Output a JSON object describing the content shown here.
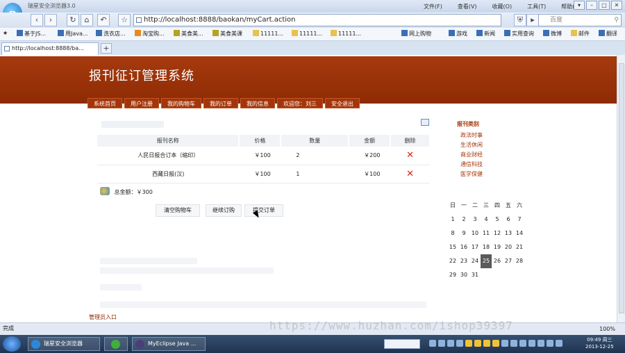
{
  "browser": {
    "window_title": "瑞星安全浏览器3.0",
    "logo": "e",
    "menu": [
      "文件(F)",
      "查看(V)",
      "收藏(O)",
      "工具(T)",
      "帮助(H)"
    ],
    "url": "http://localhost:8888/baokan/myCart.action",
    "search_placeholder": "百度",
    "tab_label": "http://localhost:8888/ba...",
    "new_tab": "+",
    "status_text": "完成",
    "zoom": "100%",
    "favorites": [
      "基于JS...",
      "用Java...",
      "洗衣店...",
      "淘宝购...",
      "美食美...",
      "美食美课",
      "11111...",
      "11111...",
      "11111...",
      "网上购物",
      "游戏",
      "新闻",
      "实用查询",
      "微博",
      "邮件",
      "翻译"
    ]
  },
  "site": {
    "title": "报刊征订管理系统",
    "menu": [
      "系统首页",
      "用户注册",
      "我的购物车",
      "我的订单",
      "我的信息",
      "欢迎您：刘三",
      "安全退出"
    ]
  },
  "cart": {
    "columns": [
      "报刊名称",
      "价格",
      "数量",
      "金额",
      "删除"
    ],
    "rows": [
      {
        "name": "人民日报合订本（缩印）",
        "price": "￥100",
        "qty": "2",
        "amount": "￥200"
      },
      {
        "name": "西藏日报(汉)",
        "price": "￥100",
        "qty": "1",
        "amount": "￥100"
      }
    ],
    "total_label": "总金额：￥300",
    "buttons": [
      "清空购物车",
      "继续订购",
      "提交订单"
    ]
  },
  "sidebar": {
    "category_title": "报刊类别",
    "categories": [
      "政法时事",
      "生活休闲",
      "商业财经",
      "通信科技",
      "医学保健"
    ]
  },
  "calendar": {
    "weekdays": [
      "日",
      "一",
      "二",
      "三",
      "四",
      "五",
      "六"
    ],
    "days": [
      "1",
      "2",
      "3",
      "4",
      "5",
      "6",
      "7",
      "8",
      "9",
      "10",
      "11",
      "12",
      "13",
      "14",
      "15",
      "16",
      "17",
      "18",
      "19",
      "20",
      "21",
      "22",
      "23",
      "24",
      "25",
      "26",
      "27",
      "28",
      "29",
      "30",
      "31"
    ],
    "today": "25"
  },
  "admin_link": "管理员入口",
  "watermark": "https://www.huzhan.com/ishop39397",
  "taskbar": {
    "tasks": [
      "瑞星安全浏览器",
      "",
      "MyEclipse Java ..."
    ],
    "clock_time": "09:49 周三",
    "clock_date": "2013-12-25"
  }
}
